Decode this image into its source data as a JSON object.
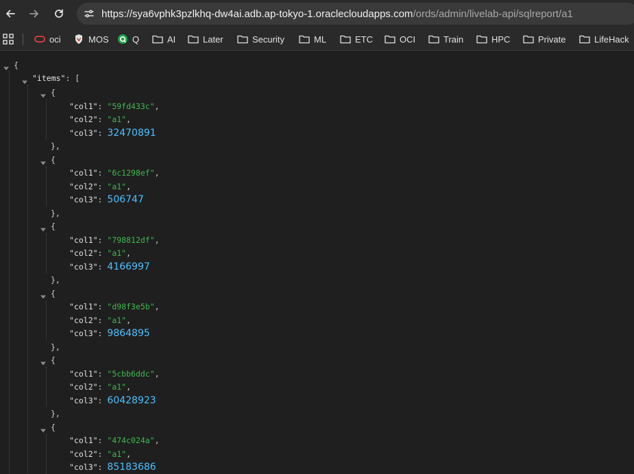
{
  "browser": {
    "url_host": "https://sya6vphk3pzlkhq-dw4ai.adb.ap-tokyo-1.oraclecloudapps.com",
    "url_path": "/ords/admin/livelab-api/sqlreport/a1"
  },
  "bookmarks": [
    {
      "label": "oci",
      "icon": "oracle-logo-icon"
    },
    {
      "label": "MOS",
      "icon": "mos-shield-icon"
    },
    {
      "label": "Q",
      "icon": "q-logo-icon"
    },
    {
      "label": "AI",
      "icon": "folder-icon"
    },
    {
      "label": "Later",
      "icon": "folder-icon"
    },
    {
      "label": "Security",
      "icon": "folder-icon"
    },
    {
      "label": "ML",
      "icon": "folder-icon"
    },
    {
      "label": "ETC",
      "icon": "folder-icon"
    },
    {
      "label": "OCI",
      "icon": "folder-icon"
    },
    {
      "label": "Train",
      "icon": "folder-icon"
    },
    {
      "label": "HPC",
      "icon": "folder-icon"
    },
    {
      "label": "Private",
      "icon": "folder-icon"
    },
    {
      "label": "LifeHack",
      "icon": "folder-icon"
    }
  ],
  "json": {
    "open_brace": "{",
    "items_key": "\"items\"",
    "items_open": ": [",
    "rows": [
      {
        "col1": "\"59fd433c\"",
        "col2": "\"a1\"",
        "col3": "32470891"
      },
      {
        "col1": "\"6c1298ef\"",
        "col2": "\"a1\"",
        "col3": "506747"
      },
      {
        "col1": "\"798812df\"",
        "col2": "\"a1\"",
        "col3": "4166997"
      },
      {
        "col1": "\"d98f3e5b\"",
        "col2": "\"a1\"",
        "col3": "9864895"
      },
      {
        "col1": "\"5cbb6ddc\"",
        "col2": "\"a1\"",
        "col3": "60428923"
      },
      {
        "col1": "\"474c024a\"",
        "col2": "\"a1\"",
        "col3": "85183686"
      }
    ],
    "keys": {
      "col1": "\"col1\"",
      "col2": "\"col2\"",
      "col3": "\"col3\""
    },
    "obj_open": "{",
    "obj_close": "},",
    "colon": ": ",
    "comma": ","
  },
  "colors": {
    "string": "#3fb950",
    "number": "#4fc1ff",
    "background": "#1f1f1f"
  }
}
